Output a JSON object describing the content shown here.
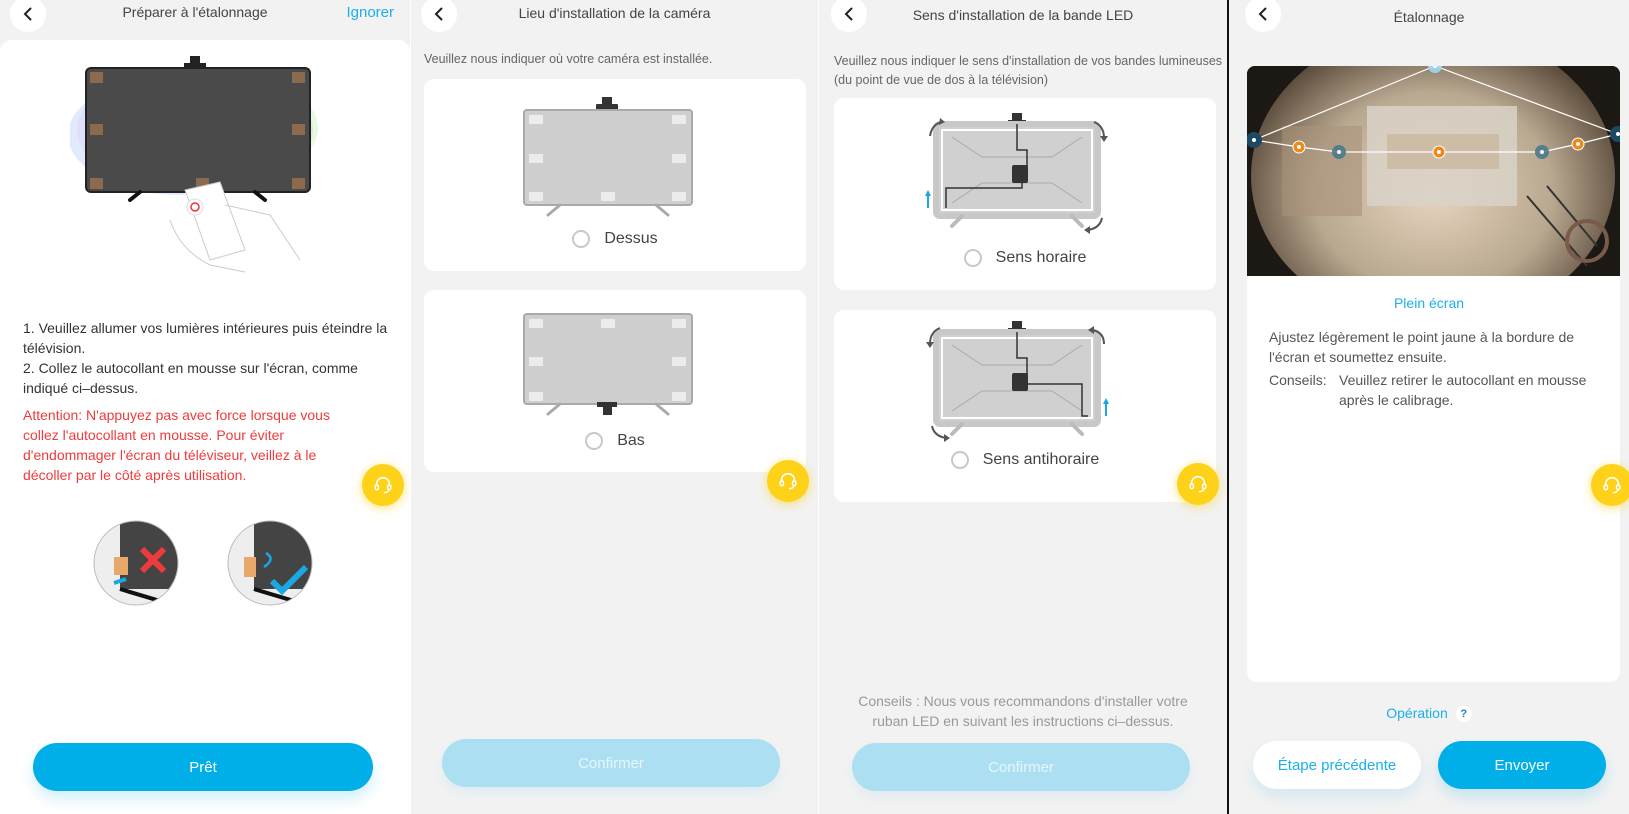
{
  "colors": {
    "accent": "#00aee8",
    "warning": "#ee3b3b",
    "help": "#ffd21a"
  },
  "panel1": {
    "title": "Préparer à l'étalonnage",
    "skip_label": "Ignorer",
    "instructions": [
      "1. Veuillez allumer vos lumières intérieures puis éteindre la télévision.",
      "2. Collez le autocollant en mousse sur l'écran, comme indiqué ci–dessus."
    ],
    "warning": "Attention: N'appuyez pas avec force lorsque vous collez l'autocollant en mousse. Pour éviter d'endommager l'écran du téléviseur, veillez à le décoller par le côté après utilisation.",
    "illustrations": {
      "wrong_icon": "cross-icon",
      "right_icon": "check-icon"
    },
    "ready_label": "Prêt"
  },
  "panel2": {
    "title": "Lieu d'installation de la caméra",
    "description": "Veuillez nous indiquer où votre caméra est installée.",
    "options": [
      {
        "label": "Dessus",
        "selected": false
      },
      {
        "label": "Bas",
        "selected": false
      }
    ],
    "confirm_label": "Confirmer"
  },
  "panel3": {
    "title": "Sens d'installation de la bande LED",
    "description": "Veuillez nous indiquer le sens d'installation de vos bandes lumineuses (du point de vue de dos à la télévision)",
    "options": [
      {
        "label": "Sens horaire",
        "selected": false
      },
      {
        "label": "Sens antihoraire",
        "selected": false
      }
    ],
    "tips": "Conseils : Nous vous recommandons d'installer votre ruban LED en suivant les instructions ci–dessus.",
    "confirm_label": "Confirmer"
  },
  "panel4": {
    "title": "Étalonnage",
    "fullscreen_label": "Plein écran",
    "instruction": "Ajustez légèrement le point jaune à la bordure de l'écran et soumettez ensuite.",
    "tips_label": "Conseils:",
    "tips_text": "Veuillez retirer le autocollant en mousse après le calibrage.",
    "operation_label": "Opération",
    "operation_help": "?",
    "prev_label": "Étape précédente",
    "send_label": "Envoyer"
  }
}
